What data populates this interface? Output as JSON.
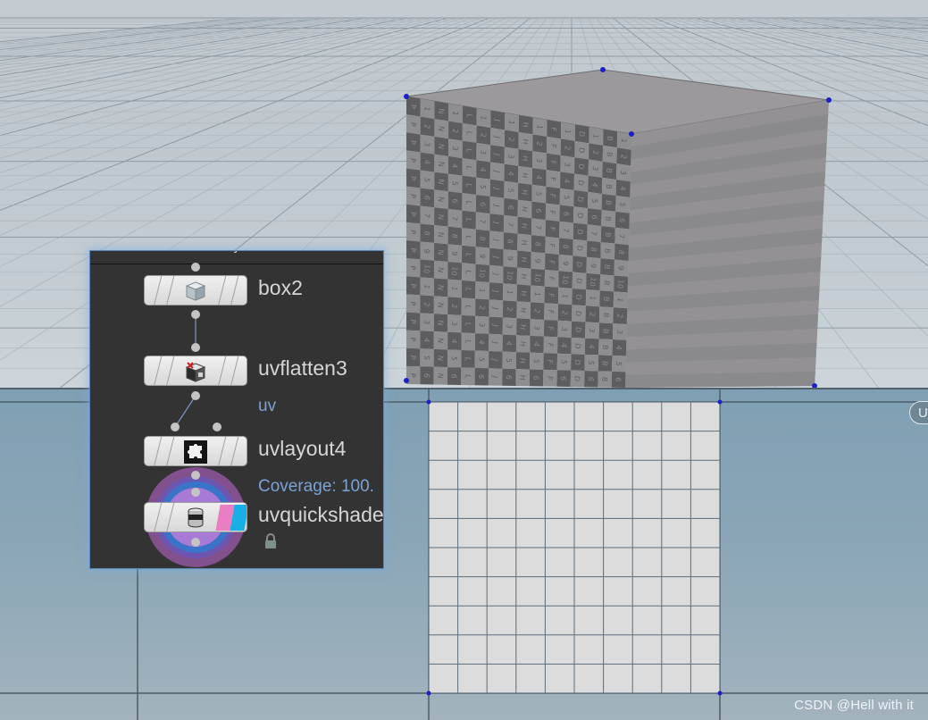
{
  "viewport_3d": {
    "object": "box",
    "checker_letters": [
      "A",
      "B",
      "C",
      "D",
      "E",
      "F",
      "G",
      "H",
      "I",
      "J",
      "K",
      "L",
      "M",
      "N",
      "O",
      "P"
    ],
    "checker_numbers": [
      "1",
      "2",
      "3",
      "4",
      "5",
      "6",
      "7",
      "8",
      "9",
      "10"
    ],
    "colors": {
      "checker_dark": "#5d5d60",
      "checker_light": "#8e8e91",
      "side_face": "#8c8a8e",
      "top_face": "#9b999c",
      "vertex": "#1b21c7"
    }
  },
  "uv_viewport": {
    "badge_text": "U",
    "grid_divisions": 10,
    "colors": {
      "uv_tile": "#dcdcdc",
      "uv_line": "#5d6e7b",
      "vertex": "#1b21c7"
    }
  },
  "network": {
    "header_fragment": "y",
    "nodes": [
      {
        "label": "box2",
        "icon": "cube-icon"
      },
      {
        "label": "uvflatten3",
        "icon": "uvflatten-icon",
        "info": "uv"
      },
      {
        "label": "uvlayout4",
        "icon": "puzzle-icon",
        "info": "Coverage: 100."
      },
      {
        "label": "uvquickshade",
        "icon": "shader-icon",
        "status_icon": "lock-icon"
      }
    ],
    "colors": {
      "panel_bg": "#333333",
      "highlight": "#5a87b6",
      "info_text": "#7aa3d8",
      "display_pink": "#ea7ec3",
      "display_cyan": "#18aee6"
    }
  },
  "watermark": "CSDN @Hell with it"
}
